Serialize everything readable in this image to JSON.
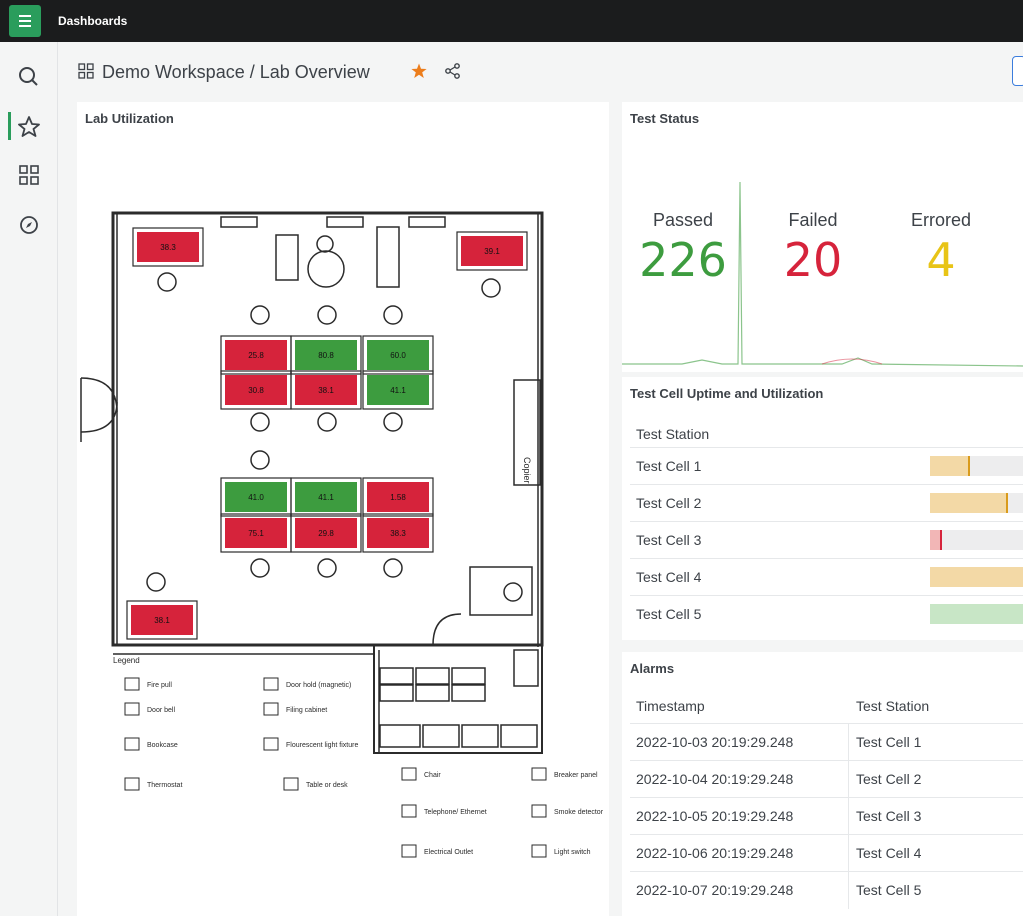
{
  "topbar": {
    "title": "Dashboards"
  },
  "header": {
    "workspace": "Demo Workspace",
    "separator": " / ",
    "page": "Lab Overview"
  },
  "panels": {
    "lab_utilization": {
      "title": "Lab Utilization"
    },
    "test_status": {
      "title": "Test Status"
    },
    "uptime": {
      "title": "Test Cell Uptime and Utilization",
      "column_header": "Test Station"
    },
    "alarms": {
      "title": "Alarms"
    }
  },
  "test_status": {
    "passed": {
      "label": "Passed",
      "value": "226",
      "color": "#3d9c3f"
    },
    "failed": {
      "label": "Failed",
      "value": "20",
      "color": "#d6233b"
    },
    "errored": {
      "label": "Errored",
      "value": "4",
      "color": "#e8c417"
    }
  },
  "uptime": {
    "rows": [
      {
        "label": "Test Cell 1",
        "fill": 0.4,
        "color": "#f3d9a6",
        "marker": "#d99b1c"
      },
      {
        "label": "Test Cell 2",
        "fill": 0.78,
        "color": "#f3d9a6",
        "marker": "#d99b1c"
      },
      {
        "label": "Test Cell 3",
        "fill": 0.12,
        "color": "#f2b6b6",
        "marker": "#d6233b"
      },
      {
        "label": "Test Cell 4",
        "fill": 1.0,
        "color": "#f3d9a6",
        "marker": ""
      },
      {
        "label": "Test Cell 5",
        "fill": 1.0,
        "color": "#c8e6c6",
        "marker": ""
      }
    ]
  },
  "alarms": {
    "headers": [
      "Timestamp",
      "Test Station"
    ],
    "rows": [
      [
        "2022-10-03 20:19:29.248",
        "Test Cell 1"
      ],
      [
        "2022-10-04 20:19:29.248",
        "Test Cell 2"
      ],
      [
        "2022-10-05 20:19:29.248",
        "Test Cell 3"
      ],
      [
        "2022-10-06 20:19:29.248",
        "Test Cell 4"
      ],
      [
        "2022-10-07 20:19:29.248",
        "Test Cell 5"
      ]
    ]
  },
  "floorplan": {
    "cells": [
      {
        "value": "38.3",
        "status": "red"
      },
      {
        "value": "39.1",
        "status": "red"
      },
      {
        "value": "25.8",
        "status": "red"
      },
      {
        "value": "80.8",
        "status": "green"
      },
      {
        "value": "60.0",
        "status": "green"
      },
      {
        "value": "30.8",
        "status": "red"
      },
      {
        "value": "38.1",
        "status": "red"
      },
      {
        "value": "41.1",
        "status": "green"
      },
      {
        "value": "41.0",
        "status": "green"
      },
      {
        "value": "41.1",
        "status": "green"
      },
      {
        "value": "1.58",
        "status": "red"
      },
      {
        "value": "75.1",
        "status": "red"
      },
      {
        "value": "29.8",
        "status": "red"
      },
      {
        "value": "38.3",
        "status": "red"
      },
      {
        "value": "38.1",
        "status": "red"
      }
    ],
    "colors": {
      "red": "#d6233b",
      "green": "#3d9c3f"
    },
    "copier_label": "Copier",
    "legend_title": "Legend",
    "legend": [
      "Fire pull",
      "Door hold (magnetic)",
      "Door bell",
      "Filing cabinet",
      "Bookcase",
      "Flourescent light fixture",
      "Thermostat",
      "Table or desk",
      "Chair",
      "Breaker panel",
      "Telephone/ Ethernet",
      "Smoke detector",
      "Electrical Outlet",
      "Light switch"
    ]
  }
}
